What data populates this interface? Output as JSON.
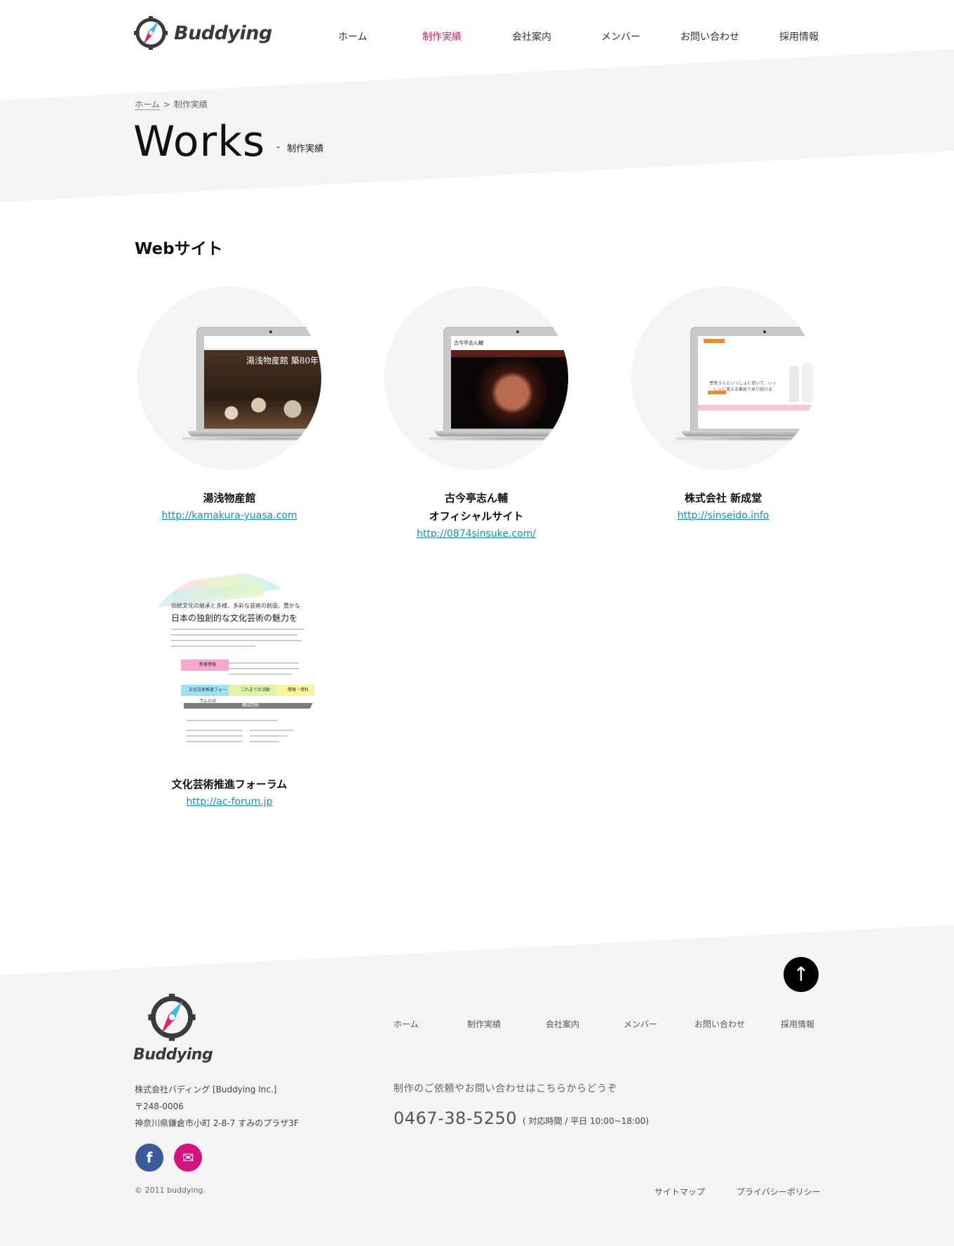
{
  "brand": {
    "name": "Buddying",
    "accent": "#d6246e"
  },
  "nav": {
    "items": [
      "ホーム",
      "制作実績",
      "会社案内",
      "メンバー",
      "お問い合わせ",
      "採用情報"
    ],
    "active_index": 1
  },
  "breadcrumb": {
    "home": "ホーム",
    "separator": ">",
    "current": "制作実績"
  },
  "page": {
    "title_en": "Works",
    "title_dash": "-",
    "title_ja": "制作実績"
  },
  "section": {
    "title_bold": "Web",
    "title_rest": "サイト"
  },
  "works": [
    {
      "name_lines": [
        "湯浅物産館"
      ],
      "url": "http://kamakura-yuasa.com",
      "screen_caption": "湯浅物産館 築80年"
    },
    {
      "name_lines": [
        "古今亭志ん輔",
        "オフィシャルサイト"
      ],
      "url": "http://0874sinsuke.com/",
      "screen_caption": "古今亭志ん輔"
    },
    {
      "name_lines": [
        "株式会社 新成堂"
      ],
      "url": "http://sinseido.info",
      "screen_caption": "患者さんといっしょに迷いて、いっしょに笑える薬局であり続ける"
    },
    {
      "name_lines": [
        "文化芸術推進フォーラム"
      ],
      "url": "http://ac-forum.jp",
      "screen_lines": [
        "伝統文化の継承と多様、多彩な芸術の創造、豊かな",
        "日本の独創的な文化芸術の魅力を"
      ],
      "screen_tags": [
        "新着情報",
        "文化芸術推進フォーラムとは",
        "これまでの活動",
        "情報・資料",
        "構成団体"
      ]
    }
  ],
  "footer": {
    "nav": [
      "ホーム",
      "制作実績",
      "会社案内",
      "メンバー",
      "お問い合わせ",
      "採用情報"
    ],
    "company": [
      "株式会社バディング [Buddying Inc.]",
      "〒248-0006",
      "神奈川県鎌倉市小町 2-8-7 すみのプラザ3F"
    ],
    "contact_lead": "制作のご依頼やお問い合わせはこちらからどうぞ",
    "tel": "0467-38-5250",
    "hours": "( 対応時間 / 平日 10:00~18:00)",
    "copyright": "© 2011 buddying.",
    "links": [
      "サイトマップ",
      "プライバシーポリシー"
    ],
    "to_top": "↑",
    "fb": "f",
    "mail": "✉"
  }
}
